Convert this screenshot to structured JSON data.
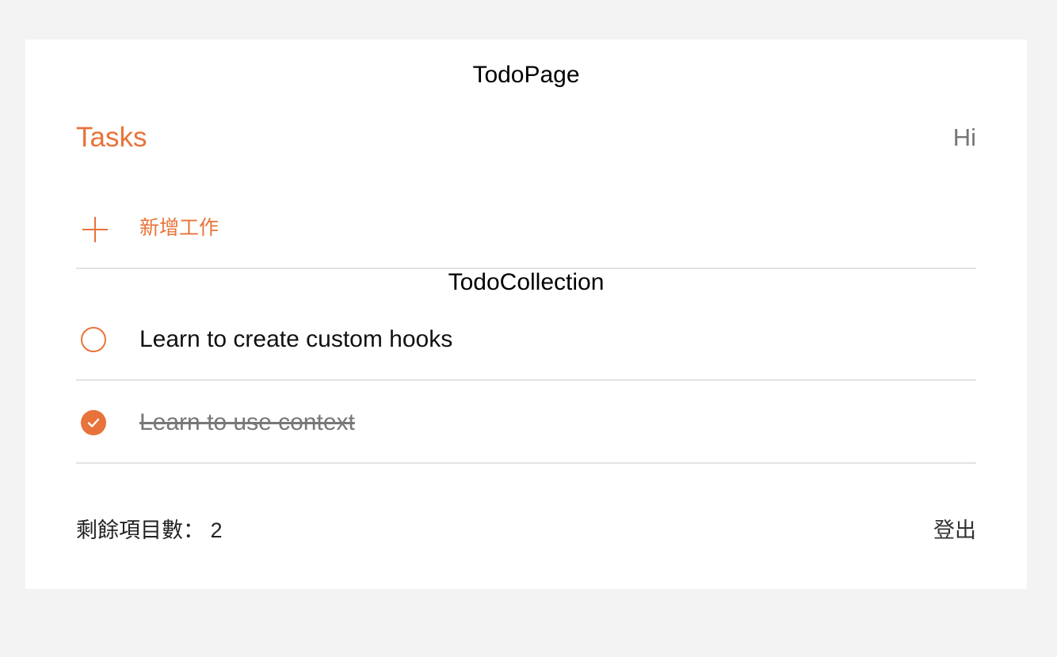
{
  "page": {
    "title": "TodoPage"
  },
  "header": {
    "title": "Tasks",
    "greeting": "Hi"
  },
  "add_task": {
    "icon": "plus-icon",
    "label": "新增工作"
  },
  "collection": {
    "title": "TodoCollection",
    "items": [
      {
        "text": "Learn to create custom hooks",
        "done": false
      },
      {
        "text": "Learn to use context",
        "done": true
      }
    ]
  },
  "footer": {
    "remaining_label": "剩餘項目數：",
    "remaining_count": "2",
    "logout_label": "登出"
  },
  "colors": {
    "accent": "#e8733a",
    "background": "#f3f3f3",
    "card": "#ffffff",
    "divider": "#e3e3e3"
  }
}
